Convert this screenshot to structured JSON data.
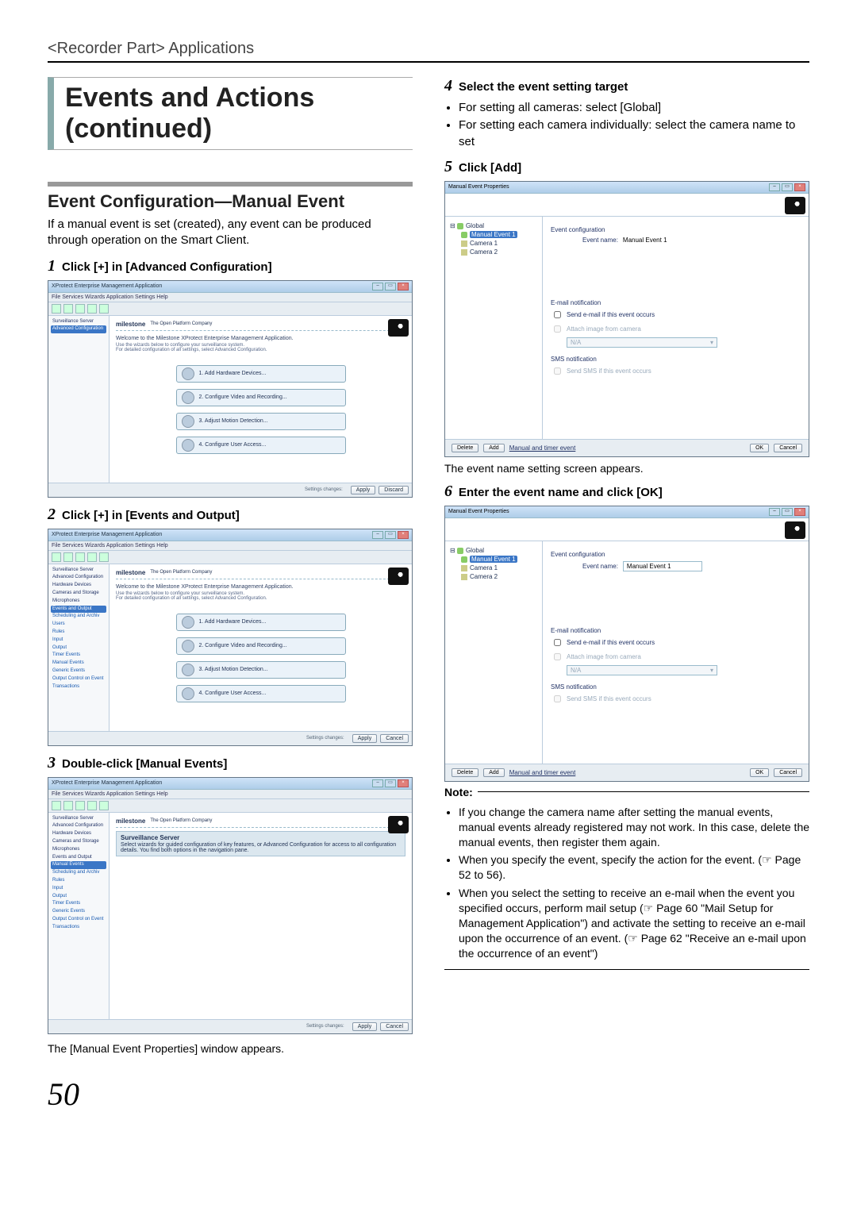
{
  "breadcrumb": "<Recorder Part> Applications",
  "main_title": "Events and Actions (continued)",
  "section_title": "Event Configuration—Manual Event",
  "intro": "If a manual event is set (created), any event can be produced through operation on the Smart Client.",
  "steps": {
    "s1": {
      "num": "1",
      "text": "Click [+] in [Advanced Configuration]"
    },
    "s2": {
      "num": "2",
      "text": "Click [+] in [Events and Output]"
    },
    "s3": {
      "num": "3",
      "text": "Double-click [Manual Events]"
    },
    "s4": {
      "num": "4",
      "text": "Select the event setting target"
    },
    "s5": {
      "num": "5",
      "text": "Click [Add]"
    },
    "s6": {
      "num": "6",
      "text": "Enter the event name and click [OK]"
    }
  },
  "s4_bullets": [
    "For setting all cameras: select [Global]",
    "For setting each camera individually: select the camera name to set"
  ],
  "caption_after_s3": "The [Manual Event Properties] window appears.",
  "caption_after_s5": "The event name setting screen appears.",
  "note_title": "Note:",
  "notes": [
    "If you change the camera name after setting the manual events, manual events already registered may not work. In this case, delete the manual events, then register them again.",
    "When you specify the event, specify the action for the event. (☞ Page 52 to 56).",
    "When you select the setting to receive an e-mail when the event you specified occurs, perform mail setup (☞ Page 60 \"Mail Setup for Management Application\") and activate the setting to receive an e-mail upon the occurrence of an event. (☞ Page 62 \"Receive an e-mail upon the occurrence of an event\")"
  ],
  "page_number": "50",
  "app_window": {
    "title": "XProtect Enterprise Management Application",
    "menubar": "File   Services   Wizards   Application Settings   Help",
    "heading_prefix": "milestone",
    "heading_sub": "The Open Platform Company",
    "welcome": "Welcome to the Milestone XProtect Enterprise Management Application.",
    "welcome_sub1": "Use the wizards below to configure your surveillance system.",
    "welcome_sub2": "For detailed configuration of all settings, select Advanced Configuration.",
    "wiz": [
      "1. Add Hardware Devices...",
      "2. Configure Video and Recording...",
      "3. Adjust Motion Detection...",
      "4. Configure User Access..."
    ],
    "status_label": "Settings changes:",
    "btn_apply": "Apply",
    "btn_discard": "Discard",
    "btn_cancel": "Cancel",
    "sidebar_s1": [
      {
        "label": "Surveillance Server",
        "sel": false
      },
      {
        "label": "Advanced Configuration",
        "sel": true
      }
    ],
    "sidebar_s2": [
      "Surveillance Server",
      "Advanced Configuration",
      "  Hardware Devices",
      "  Cameras and Storage",
      "  Microphones",
      "  Events and Output",
      "  Scheduling and Archiv",
      "  Users",
      "  Rules",
      "  Input",
      "  Output",
      "  Timer Events",
      "  Manual Events",
      "  Generic Events",
      "  Output Control on Event",
      "  Transactions"
    ],
    "sidebar_s3_sel": "Manual Events",
    "surv_title": "Surveillance Server",
    "surv_text": "Select wizards for guided configuration of key features, or Advanced Configuration for access to all configuration details. You find both options in the navigation pane."
  },
  "mep": {
    "title": "Manual Event Properties",
    "tree": {
      "root": "Global",
      "sel": "Manual Event 1",
      "cam1": "Camera 1",
      "cam2": "Camera 2"
    },
    "grp_event": "Event configuration",
    "lbl_eventname": "Event name:",
    "val_eventname": "Manual Event 1",
    "grp_email": "E-mail notification",
    "chk_email": "Send e-mail if this event occurs",
    "chk_attach": "Attach image from camera",
    "sel_na": "N/A",
    "grp_sms": "SMS notification",
    "chk_sms": "Send SMS if this event occurs",
    "btn_delete": "Delete",
    "btn_add": "Add",
    "link_hint": "Manual and timer event",
    "btn_ok": "OK",
    "btn_cancel": "Cancel"
  }
}
